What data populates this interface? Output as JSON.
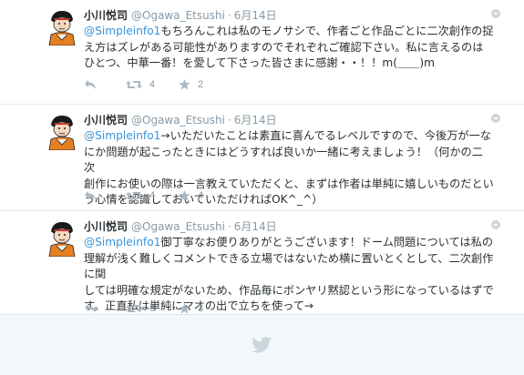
{
  "tweets": [
    {
      "name": "小川悦司",
      "handle": "@Ogawa_Etsushi",
      "separator": "·",
      "date": "6月14日",
      "mention": "",
      "lines": [
        "もちろんこれは私のモノサシで、作者ごと作品ごとに二次創作の捉",
        "え方はズレがある可能性がありますのでそれぞれご確認下さい。私に言えるのは",
        "ひとつ、中華一番！を愛して下さった皆さまに感謝・・！！m(＿＿)m"
      ],
      "mention_inline": "@Simpleinfo1",
      "retweets": "4",
      "favorites": "2"
    },
    {
      "name": "小川悦司",
      "handle": "@Ogawa_Etsushi",
      "separator": "·",
      "date": "6月14日",
      "mention_inline": "@Simpleinfo1",
      "lines": [
        "→いただいたことは素直に喜んでるレベルですので、今後万が一な",
        "にか問題が起こったときにはどうすれば良いか一緒に考えましょう！（何かの二次",
        "創作にお使いの際は一言教えていただくと、まずは作者は単純に嬉しいものだとい",
        "う心情を認識しておいていただければOK^_^）"
      ],
      "retweets": "4",
      "favorites": "4"
    },
    {
      "name": "小川悦司",
      "handle": "@Ogawa_Etsushi",
      "separator": "·",
      "date": "6月14日",
      "mention_inline": "@Simpleinfo1",
      "lines": [
        "御丁寧なお便りありがとうございます！ドーム問題については私の",
        "理解が浅く難しくコメントできる立場ではないため横に置いとくとして、二次創作に関",
        "しては明確な規定がないため、作品毎にボンヤリ黙認という形になっているはずで",
        "す。正直私は単純にマオの出で立ちを使って→"
      ],
      "retweets": "6",
      "favorites": "3"
    }
  ],
  "icons": {
    "reply": "reply-icon",
    "retweet": "retweet-icon",
    "favorite": "star-icon",
    "more": "chevron-down-icon",
    "footer": "twitter-bird-icon"
  },
  "colors": {
    "link": "#3b94d9",
    "meta": "#8899a6",
    "text": "#292f33",
    "background": "#f5f8fa"
  }
}
